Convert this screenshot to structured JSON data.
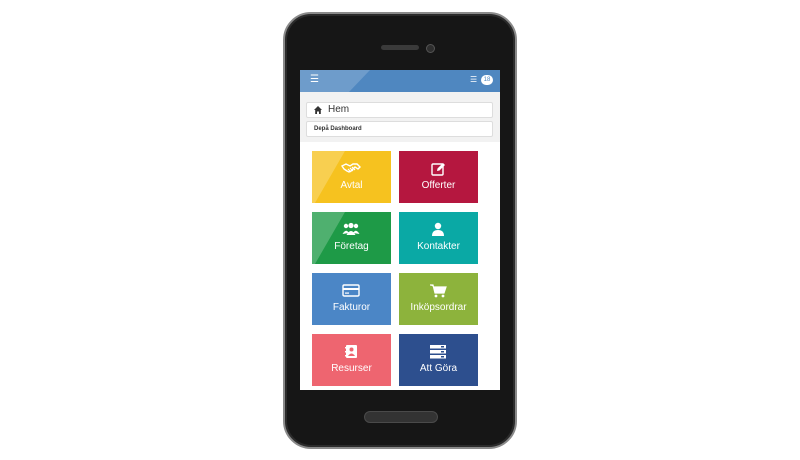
{
  "topbar": {
    "menu_icon": "menu-icon",
    "list_icon": "list-icon",
    "badge_count": "18"
  },
  "breadcrumb": {
    "label": "Hem",
    "icon": "home-icon"
  },
  "subbar": {
    "label": "Depå Dashboard"
  },
  "tiles": [
    {
      "label": "Avtal",
      "icon": "handshake-icon",
      "color": "#f6c21f"
    },
    {
      "label": "Offerter",
      "icon": "edit-icon",
      "color": "#b5173f"
    },
    {
      "label": "Företag",
      "icon": "users-icon",
      "color": "#1e9a47"
    },
    {
      "label": "Kontakter",
      "icon": "user-icon",
      "color": "#0aa9a5"
    },
    {
      "label": "Fakturor",
      "icon": "credit-card-icon",
      "color": "#4b86c6"
    },
    {
      "label": "Inköpsordrar",
      "icon": "cart-icon",
      "color": "#8db33c"
    },
    {
      "label": "Resurser",
      "icon": "contact-book-icon",
      "color": "#ee6570"
    },
    {
      "label": "Att Göra",
      "icon": "server-list-icon",
      "color": "#2d4f8e"
    }
  ]
}
